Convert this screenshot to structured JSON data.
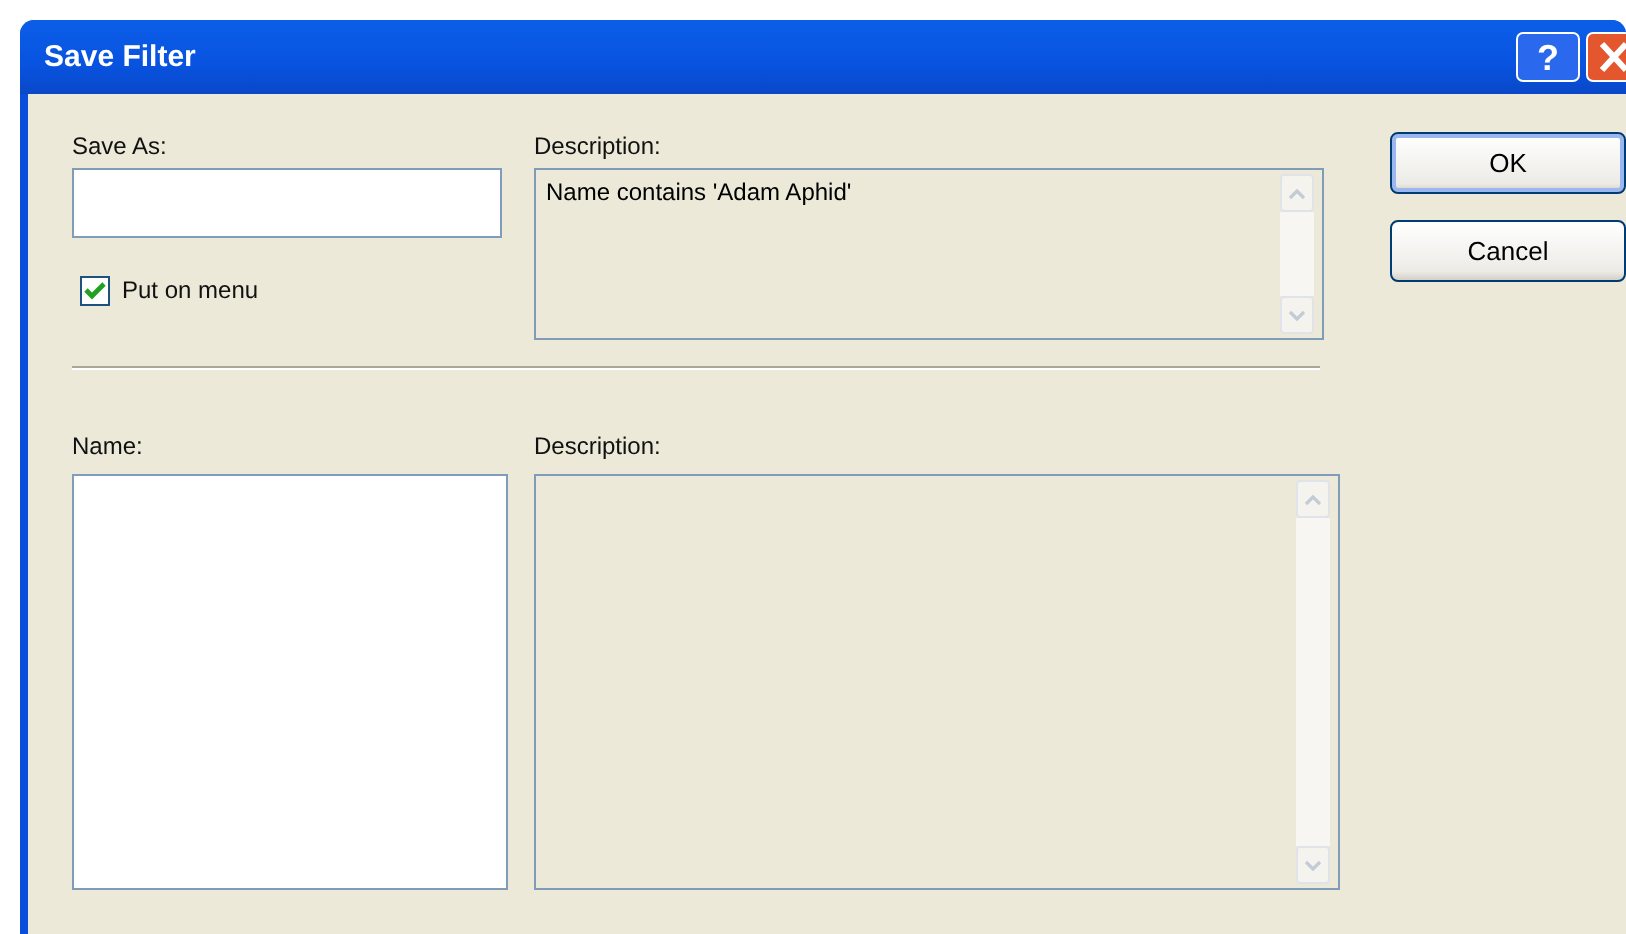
{
  "window": {
    "title": "Save Filter",
    "help_glyph": "?"
  },
  "save_as": {
    "label": "Save As:"
  },
  "put_on_menu": {
    "label": "Put on menu",
    "checked": true
  },
  "description": {
    "label": "Description:",
    "value": "Name  contains 'Adam Aphid'"
  },
  "name_list": {
    "label": "Name:"
  },
  "name_description": {
    "label": "Description:"
  },
  "buttons": [
    {
      "label": "OK",
      "default": true
    },
    {
      "label": "Cancel",
      "default": false
    }
  ]
}
